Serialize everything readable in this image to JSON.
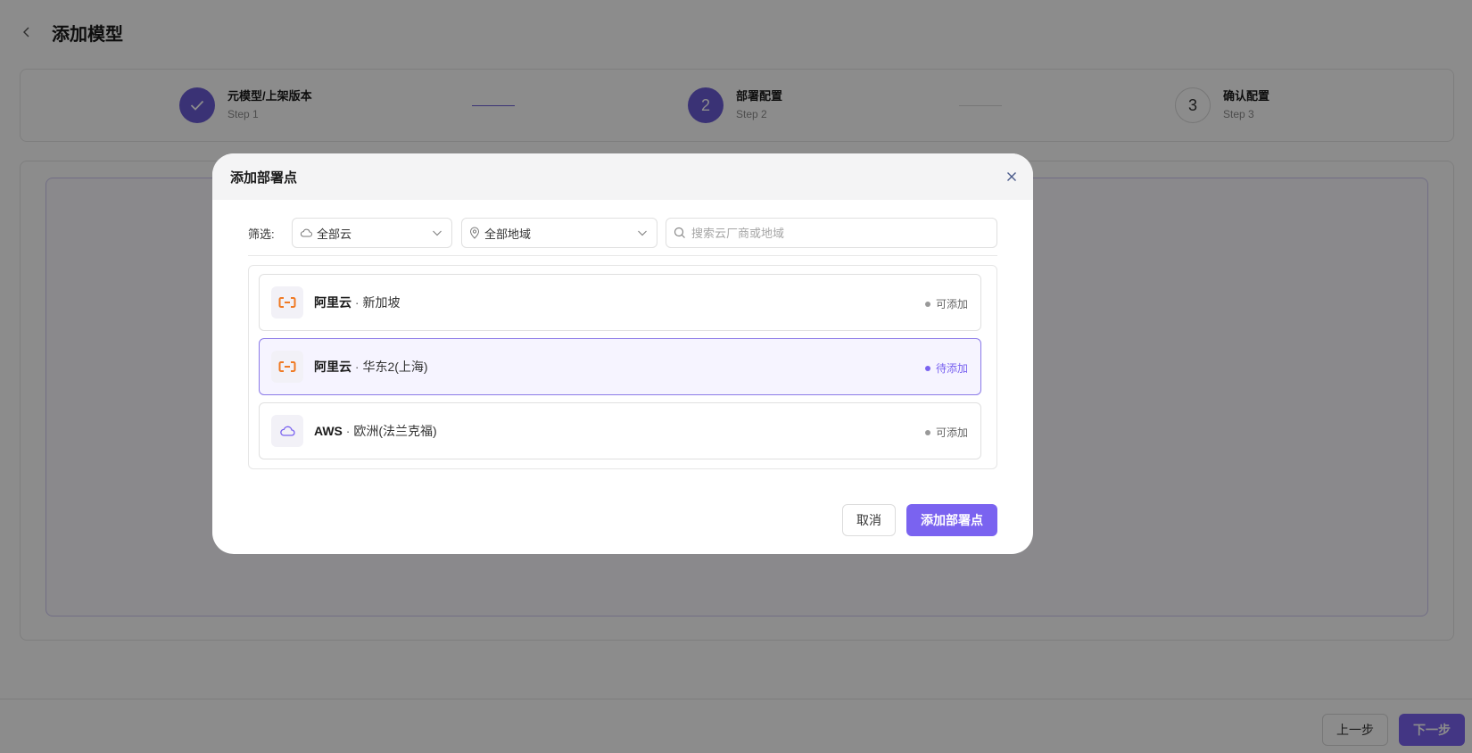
{
  "page": {
    "title": "添加模型"
  },
  "steps": [
    {
      "title": "元模型/上架版本",
      "sub": "Step 1",
      "state": "done"
    },
    {
      "title": "部署配置",
      "sub": "Step 2",
      "state": "active",
      "number": "2"
    },
    {
      "title": "确认配置",
      "sub": "Step 3",
      "state": "pending",
      "number": "3"
    }
  ],
  "footer": {
    "prev_label": "上一步",
    "next_label": "下一步"
  },
  "modal": {
    "title": "添加部署点",
    "filter_label": "筛选:",
    "cloud_select": {
      "value": "全部云",
      "icon": "cloud-icon"
    },
    "region_select": {
      "value": "全部地域",
      "icon": "location-pin-icon"
    },
    "search": {
      "placeholder": "搜索云厂商或地域",
      "value": ""
    },
    "items": [
      {
        "provider": "阿里云",
        "separator": " · ",
        "region": "新加坡",
        "status": "可添加",
        "icon": "aliyun-icon",
        "selected": false
      },
      {
        "provider": "阿里云",
        "separator": " · ",
        "region": "华东2(上海)",
        "status": "待添加",
        "icon": "aliyun-icon",
        "selected": true
      },
      {
        "provider": "AWS",
        "separator": " · ",
        "region": "欧洲(法兰克福)",
        "status": "可添加",
        "icon": "cloud-icon",
        "selected": false
      }
    ],
    "cancel_label": "取消",
    "confirm_label": "添加部署点"
  },
  "colors": {
    "accent": "#7a63f0",
    "step_done": "#6b5bd6",
    "aliyun_orange": "#f07a24"
  }
}
